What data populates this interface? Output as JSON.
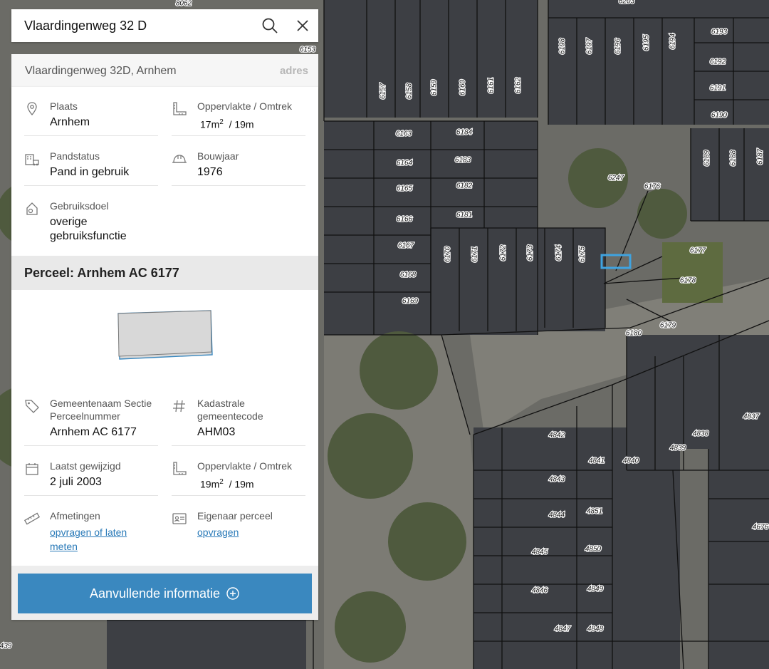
{
  "search": {
    "query": "Vlaardingenweg 32 D"
  },
  "suggestion": {
    "address": "Vlaardingenweg 32D, Arnhem",
    "type_tag": "adres"
  },
  "building": {
    "plaats": {
      "label": "Plaats",
      "value": "Arnhem"
    },
    "oppervlakte": {
      "label": "Oppervlakte / Omtrek",
      "area": "17m",
      "area_unit_exp": "2",
      "perimeter": "/ 19m"
    },
    "pandstatus": {
      "label": "Pandstatus",
      "value": "Pand in gebruik"
    },
    "bouwjaar": {
      "label": "Bouwjaar",
      "value": "1976"
    },
    "gebruiksdoel": {
      "label": "Gebruiksdoel",
      "value": "overige gebruiksfunctie"
    }
  },
  "perceel": {
    "title": "Perceel: Arnhem AC 6177",
    "gemeentenaam": {
      "label": "Gemeentenaam Sectie Perceelnummer",
      "value": "Arnhem AC 6177"
    },
    "kadastrale": {
      "label": "Kadastrale gemeentecode",
      "value": "AHM03"
    },
    "gewijzigd": {
      "label": "Laatst gewijzigd",
      "value": "2 juli 2003"
    },
    "oppervlakte": {
      "label": "Oppervlakte / Omtrek",
      "area": "19m",
      "area_unit_exp": "2",
      "perimeter": "/ 19m"
    },
    "afmetingen": {
      "label": "Afmetingen",
      "link": "opvragen of laten meten"
    },
    "eigenaar": {
      "label": "Eigenaar perceel",
      "link": "opvragen"
    }
  },
  "more_button": {
    "label": "Aanvullende informatie"
  },
  "map": {
    "selected_parcel": "6177",
    "parcel_labels": [
      {
        "text": "8062"
      },
      {
        "text": "6203"
      },
      {
        "text": "6153"
      },
      {
        "text": "6193"
      },
      {
        "text": "6192"
      },
      {
        "text": "6191"
      },
      {
        "text": "6190"
      },
      {
        "text": "6197"
      },
      {
        "text": "6196"
      },
      {
        "text": "6195"
      },
      {
        "text": "6194"
      },
      {
        "text": "6198"
      },
      {
        "text": "6157"
      },
      {
        "text": "6158"
      },
      {
        "text": "6159"
      },
      {
        "text": "6160"
      },
      {
        "text": "6161"
      },
      {
        "text": "6162"
      },
      {
        "text": "6163"
      },
      {
        "text": "6164"
      },
      {
        "text": "6165"
      },
      {
        "text": "6166"
      },
      {
        "text": "6167"
      },
      {
        "text": "6168"
      },
      {
        "text": "6169"
      },
      {
        "text": "6184"
      },
      {
        "text": "6183"
      },
      {
        "text": "6182"
      },
      {
        "text": "6181"
      },
      {
        "text": "6170"
      },
      {
        "text": "6171"
      },
      {
        "text": "6172"
      },
      {
        "text": "6173"
      },
      {
        "text": "6174"
      },
      {
        "text": "6175"
      },
      {
        "text": "6247"
      },
      {
        "text": "6176"
      },
      {
        "text": "6177"
      },
      {
        "text": "6178"
      },
      {
        "text": "6179"
      },
      {
        "text": "6180"
      },
      {
        "text": "6189"
      },
      {
        "text": "6188"
      },
      {
        "text": "6187"
      },
      {
        "text": "4837"
      },
      {
        "text": "4838"
      },
      {
        "text": "4839"
      },
      {
        "text": "4840"
      },
      {
        "text": "4841"
      },
      {
        "text": "4842"
      },
      {
        "text": "4843"
      },
      {
        "text": "4844"
      },
      {
        "text": "4845"
      },
      {
        "text": "4846"
      },
      {
        "text": "4847"
      },
      {
        "text": "4848"
      },
      {
        "text": "4849"
      },
      {
        "text": "4850"
      },
      {
        "text": "4851"
      },
      {
        "text": "4676"
      },
      {
        "text": "439"
      }
    ]
  }
}
